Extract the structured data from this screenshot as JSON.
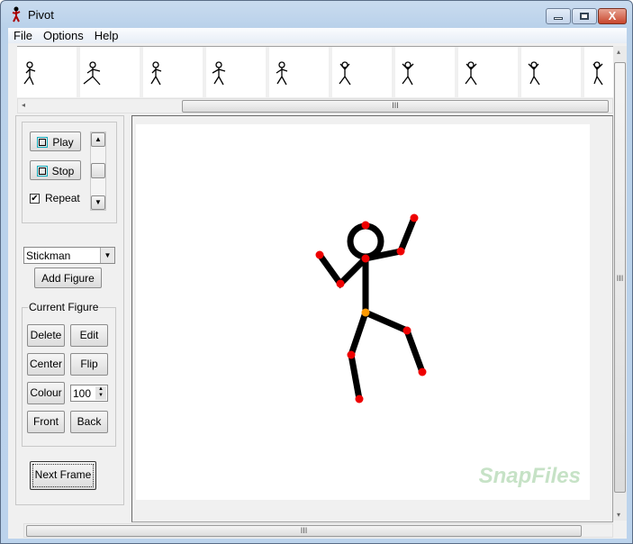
{
  "window": {
    "title": "Pivot",
    "close_glyph": "X"
  },
  "menu": [
    "File",
    "Options",
    "Help"
  ],
  "frames": {
    "count": 10
  },
  "animation": {
    "play": "Play",
    "stop": "Stop",
    "repeat_label": "Repeat",
    "repeat_checked": true
  },
  "figure_select": {
    "value": "Stickman"
  },
  "add_figure": "Add Figure",
  "current_figure": {
    "legend": "Current Figure",
    "delete": "Delete",
    "edit": "Edit",
    "center": "Center",
    "flip": "Flip",
    "colour": "Colour",
    "scale": "100",
    "front": "Front",
    "back": "Back"
  },
  "next_frame": "Next Frame",
  "watermark": "SnapFiles",
  "scroll_grip": "III"
}
